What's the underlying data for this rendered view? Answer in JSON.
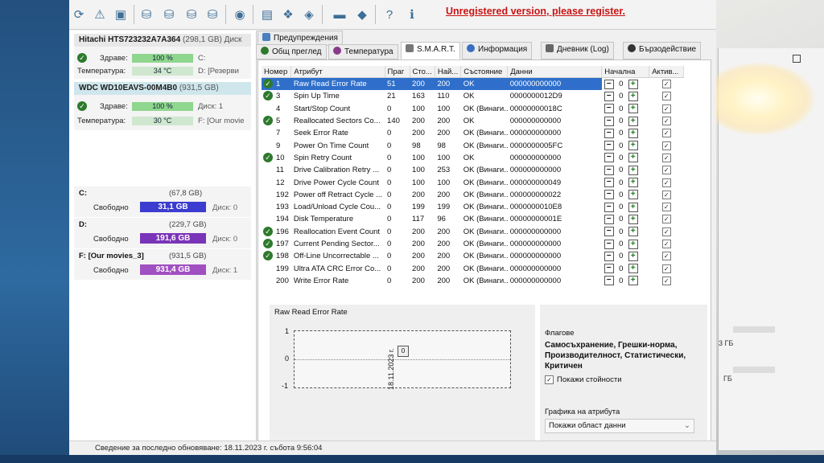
{
  "unregistered": "Unregistered version, please register.",
  "disks": [
    {
      "title": "Hitachi HTS723232A7A364",
      "size": "(298,1 GB)",
      "tail": "Диск",
      "health_label": "Здраве:",
      "health": "100 %",
      "health_drive": "C:",
      "temp_label": "Температура:",
      "temp": "34 °C",
      "temp_drive": "D: [Резерви"
    },
    {
      "title": "WDC WD10EAVS-00M4B0",
      "size": "(931,5 GB)",
      "tail": "",
      "health_label": "Здраве:",
      "health": "100 %",
      "health_drive": "Диск: 1",
      "temp_label": "Температура:",
      "temp": "30 °C",
      "temp_drive": "F: [Our movie"
    }
  ],
  "volumes": [
    {
      "name": "C:",
      "size": "(67,8 GB)",
      "free_label": "Свободно",
      "free": "31,1 GB",
      "disk": "Диск: 0",
      "color": "#3c3cd0"
    },
    {
      "name": "D:",
      "size": "(229,7 GB)",
      "free_label": "Свободно",
      "free": "191,6 GB",
      "disk": "Диск: 0",
      "color": "#7a34b8"
    },
    {
      "name": "F: [Our movies_3]",
      "size": "(931,5 GB)",
      "free_label": "Свободно",
      "free": "931,4 GB",
      "disk": "Диск: 1",
      "color": "#a050c0"
    }
  ],
  "tabs": {
    "warnings": "Предупреждения",
    "overview": "Общ преглед",
    "temperature": "Температура",
    "smart": "S.M.A.R.T.",
    "info": "Информация",
    "log": "Дневник (Log)",
    "perf": "Бързодействие"
  },
  "table": {
    "headers": [
      "Номер",
      "Атрибут",
      "Праг",
      "Сто...",
      "Най...",
      "Състояние",
      "Данни",
      "Начална",
      "Актив..."
    ],
    "rows": [
      {
        "id": "1",
        "attr": "Raw Read Error Rate",
        "thr": "51",
        "val": "200",
        "worst": "200",
        "state": "OK",
        "data": "000000000000",
        "init": "0",
        "ok": true
      },
      {
        "id": "3",
        "attr": "Spin Up Time",
        "thr": "21",
        "val": "163",
        "worst": "110",
        "state": "OK",
        "data": "0000000012D9",
        "init": "0",
        "ok": true
      },
      {
        "id": "4",
        "attr": "Start/Stop Count",
        "thr": "0",
        "val": "100",
        "worst": "100",
        "state": "OK (Винаги...",
        "data": "00000000018C",
        "init": "0",
        "ok": false
      },
      {
        "id": "5",
        "attr": "Reallocated Sectors Co...",
        "thr": "140",
        "val": "200",
        "worst": "200",
        "state": "OK",
        "data": "000000000000",
        "init": "0",
        "ok": true
      },
      {
        "id": "7",
        "attr": "Seek Error Rate",
        "thr": "0",
        "val": "200",
        "worst": "200",
        "state": "OK (Винаги...",
        "data": "000000000000",
        "init": "0",
        "ok": false
      },
      {
        "id": "9",
        "attr": "Power On Time Count",
        "thr": "0",
        "val": "98",
        "worst": "98",
        "state": "OK (Винаги...",
        "data": "0000000005FC",
        "init": "0",
        "ok": false
      },
      {
        "id": "10",
        "attr": "Spin Retry Count",
        "thr": "0",
        "val": "100",
        "worst": "100",
        "state": "OK",
        "data": "000000000000",
        "init": "0",
        "ok": true
      },
      {
        "id": "11",
        "attr": "Drive Calibration Retry ...",
        "thr": "0",
        "val": "100",
        "worst": "253",
        "state": "OK (Винаги...",
        "data": "000000000000",
        "init": "0",
        "ok": false
      },
      {
        "id": "12",
        "attr": "Drive Power Cycle Count",
        "thr": "0",
        "val": "100",
        "worst": "100",
        "state": "OK (Винаги...",
        "data": "000000000049",
        "init": "0",
        "ok": false
      },
      {
        "id": "192",
        "attr": "Power off Retract Cycle ...",
        "thr": "0",
        "val": "200",
        "worst": "200",
        "state": "OK (Винаги...",
        "data": "000000000022",
        "init": "0",
        "ok": false
      },
      {
        "id": "193",
        "attr": "Load/Unload Cycle Cou...",
        "thr": "0",
        "val": "199",
        "worst": "199",
        "state": "OK (Винаги...",
        "data": "0000000010E8",
        "init": "0",
        "ok": false
      },
      {
        "id": "194",
        "attr": "Disk Temperature",
        "thr": "0",
        "val": "117",
        "worst": "96",
        "state": "OK (Винаги...",
        "data": "00000000001E",
        "init": "0",
        "ok": false
      },
      {
        "id": "196",
        "attr": "Reallocation Event Count",
        "thr": "0",
        "val": "200",
        "worst": "200",
        "state": "OK (Винаги...",
        "data": "000000000000",
        "init": "0",
        "ok": true
      },
      {
        "id": "197",
        "attr": "Current Pending Sector...",
        "thr": "0",
        "val": "200",
        "worst": "200",
        "state": "OK (Винаги...",
        "data": "000000000000",
        "init": "0",
        "ok": true
      },
      {
        "id": "198",
        "attr": "Off-Line Uncorrectable ...",
        "thr": "0",
        "val": "200",
        "worst": "200",
        "state": "OK (Винаги...",
        "data": "000000000000",
        "init": "0",
        "ok": true
      },
      {
        "id": "199",
        "attr": "Ultra ATA CRC Error Co...",
        "thr": "0",
        "val": "200",
        "worst": "200",
        "state": "OK (Винаги...",
        "data": "000000000000",
        "init": "0",
        "ok": false
      },
      {
        "id": "200",
        "attr": "Write Error Rate",
        "thr": "0",
        "val": "200",
        "worst": "200",
        "state": "OK (Винаги...",
        "data": "000000000000",
        "init": "0",
        "ok": false
      }
    ]
  },
  "graph": {
    "title": "Raw Read Error Rate",
    "y_max": "1",
    "y_mid": "0",
    "y_min": "-1",
    "point": "0",
    "date": "18.11.2023 г."
  },
  "flags": {
    "title": "Флагове",
    "value": "Самосъхранение, Грешки-норма, Производителност, Статистически, Критичен",
    "show_values": "Покажи стойности",
    "graph_label": "Графика на атрибута",
    "graph_option": "Покажи област данни"
  },
  "status": "Сведение за последно обновяване: 18.11.2023 г. събота 9:56:04",
  "bg": {
    "a": "3 ГБ",
    "b": "ГБ"
  },
  "colors": {
    "accent": "#2f6fcb",
    "warning": "#c81414",
    "ok": "#2d7a2d"
  }
}
